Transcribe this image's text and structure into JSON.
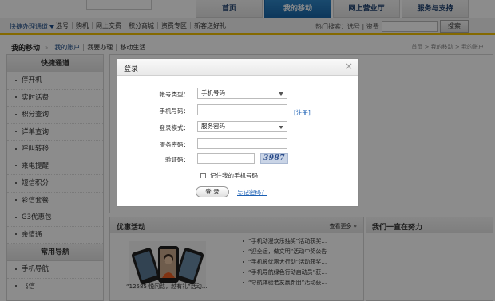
{
  "main_nav": {
    "tabs": [
      {
        "label": "首页"
      },
      {
        "label": "我的移动"
      },
      {
        "label": "网上营业厅"
      },
      {
        "label": "服务与支持"
      }
    ]
  },
  "subbar": {
    "quick_channel": "快捷办理通道",
    "links": [
      "选号",
      "购机",
      "网上交费",
      "积分商城",
      "资费专区",
      "新客送好礼"
    ],
    "hot_search_label": "热门搜索：选号 | 资费",
    "search_button": "搜索"
  },
  "breadcrumb": {
    "section": "我的移动",
    "links": [
      "我的账户",
      "我要办理",
      "移动生活"
    ],
    "path": "首页 > 我的移动 > 我的账户"
  },
  "sidebar": {
    "quick_title": "快捷通道",
    "quick_items": [
      "停开机",
      "实时话费",
      "积分查询",
      "详单查询",
      "呼叫转移",
      "来电提醒",
      "短信积分",
      "彩信套餐",
      "G3优惠包",
      "亲情通"
    ],
    "common_title": "常用导航",
    "common_items": [
      "手机导航",
      "飞信"
    ]
  },
  "promo": {
    "title": "优惠活动",
    "more": "查看更多 »",
    "caption": "“12585 悦问路，越有礼”活动…",
    "items": [
      "“手机动漫欢乐抽奖”活动获奖…",
      "“迎全运，做文明”活动中奖公告",
      "“手机报优惠大行动”活动获奖…",
      "“手机导航绿色行动启动员”获…",
      "“导航体验老友赢新朋”活动获…"
    ]
  },
  "always": {
    "title": "我们一直在努力"
  },
  "login_modal": {
    "title": "登录",
    "close": "×",
    "account_type_label": "帐号类型：",
    "account_type_value": "手机号码",
    "phone_label": "手机号码：",
    "register_link": "[注册]",
    "login_mode_label": "登录模式：",
    "login_mode_value": "服务密码",
    "password_label": "服务密码：",
    "captcha_label": "验证码：",
    "captcha_text": "3987",
    "remember_label": "记住我的手机号码",
    "login_button": "登 录",
    "forgot_link": "忘记密码？"
  }
}
